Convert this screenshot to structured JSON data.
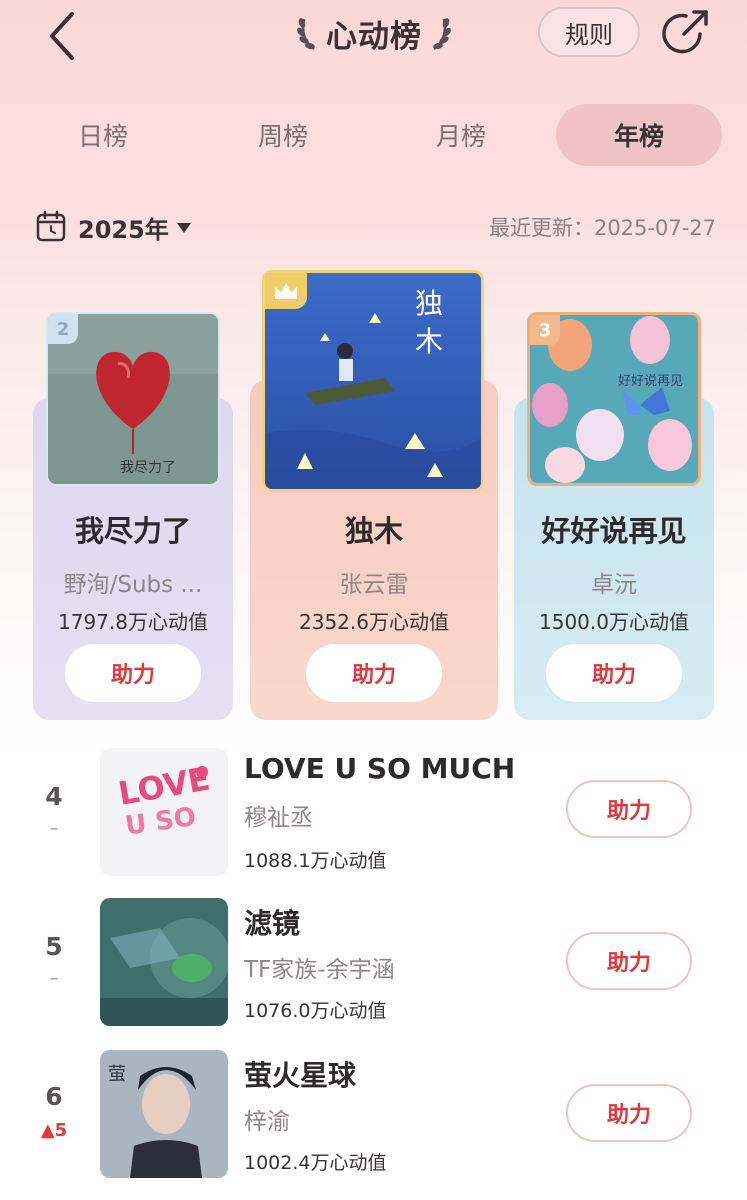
{
  "header": {
    "back_icon": "chevron-left-icon",
    "title": "心动榜",
    "rules_label": "规则",
    "share_icon": "share-arrow-icon"
  },
  "tabs": [
    {
      "label": "日榜",
      "active": false
    },
    {
      "label": "周榜",
      "active": false
    },
    {
      "label": "月榜",
      "active": false
    },
    {
      "label": "年榜",
      "active": true
    }
  ],
  "filter": {
    "year_label": "2025年",
    "updated_text": "最近更新：2025-07-27"
  },
  "podium": [
    {
      "rank": "2",
      "song": "我尽力了",
      "artist": "野洵/Subs ...",
      "score": "1797.8万心动值",
      "boost_label": "助力"
    },
    {
      "rank": "1",
      "song": "独木",
      "artist": "张云雷",
      "score": "2352.6万心动值",
      "boost_label": "助力"
    },
    {
      "rank": "3",
      "song": "好好说再见",
      "artist": "卓沅",
      "score": "1500.0万心动值",
      "boost_label": "助力"
    }
  ],
  "list": [
    {
      "rank": "4",
      "change": "–",
      "change_dir": "same",
      "song": "LOVE U SO MUCH",
      "artist": "穆祉丞",
      "score": "1088.1万心动值",
      "boost_label": "助力"
    },
    {
      "rank": "5",
      "change": "–",
      "change_dir": "same",
      "song": "滤镜",
      "artist": "TF家族-余宇涵",
      "score": "1076.0万心动值",
      "boost_label": "助力"
    },
    {
      "rank": "6",
      "change": "▲5",
      "change_dir": "up",
      "song": "萤火星球",
      "artist": "梓渝",
      "score": "1002.4万心动值",
      "boost_label": "助力"
    }
  ],
  "colors": {
    "accent_red": "#e0383c",
    "tab_active_bg": "#f0c4c4",
    "gold_border": "#f3d27a"
  }
}
